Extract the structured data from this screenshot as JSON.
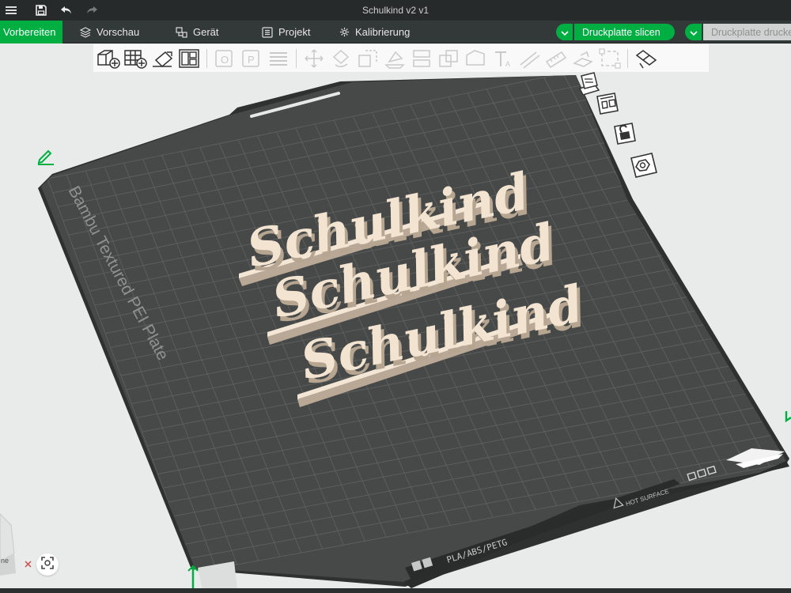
{
  "window": {
    "title": "Schulkind v2 v1"
  },
  "titlebar_icons": [
    "menu-icon",
    "save-icon",
    "undo-icon",
    "redo-icon"
  ],
  "nav": {
    "tabs": [
      {
        "label": "Vorbereiten",
        "icon": "none",
        "active": true
      },
      {
        "label": "Vorschau",
        "icon": "layers-icon",
        "active": false
      },
      {
        "label": "Gerät",
        "icon": "device-icon",
        "active": false
      },
      {
        "label": "Projekt",
        "icon": "project-icon",
        "active": false
      },
      {
        "label": "Kalibrierung",
        "icon": "calibration-icon",
        "active": false
      }
    ],
    "slice_label": "Druckplatte slicen",
    "print_label": "Druckplatte drucken"
  },
  "toolbar": {
    "tools": [
      "add-object-icon",
      "add-plate-icon",
      "auto-orient-icon",
      "arrange-icon",
      "split-objects-icon",
      "split-parts-icon",
      "layers-list-icon",
      "move-icon",
      "rotate-icon",
      "scale-icon",
      "lay-on-face-icon",
      "cut-icon",
      "mesh-boolean-icon",
      "support-paint-icon",
      "seam-paint-icon",
      "text-icon",
      "measure-icon",
      "assembly-icon",
      "variable-layer-icon",
      "explode-icon"
    ]
  },
  "viewport": {
    "plate_label": "Bambu Textured PEI Plate",
    "filament_label": "PLA/ABS/PETG",
    "hot_surface_label": "HOT SURFACE",
    "model_text": [
      "Schulkind",
      "Schulkind",
      "Schulkind"
    ],
    "nav_cube_label": "ne",
    "colors": {
      "plate": "#474948",
      "grid": "#5d5f5e",
      "plate_border": "#2f3130",
      "model": "#f3e4d2",
      "model_shadow": "#b7a693",
      "accent": "#00ae42",
      "background": "#e9ebea"
    }
  },
  "plate_side_buttons": [
    "plate-auto-orient-icon",
    "plate-arrange-icon",
    "plate-lock-icon",
    "plate-settings-icon"
  ]
}
